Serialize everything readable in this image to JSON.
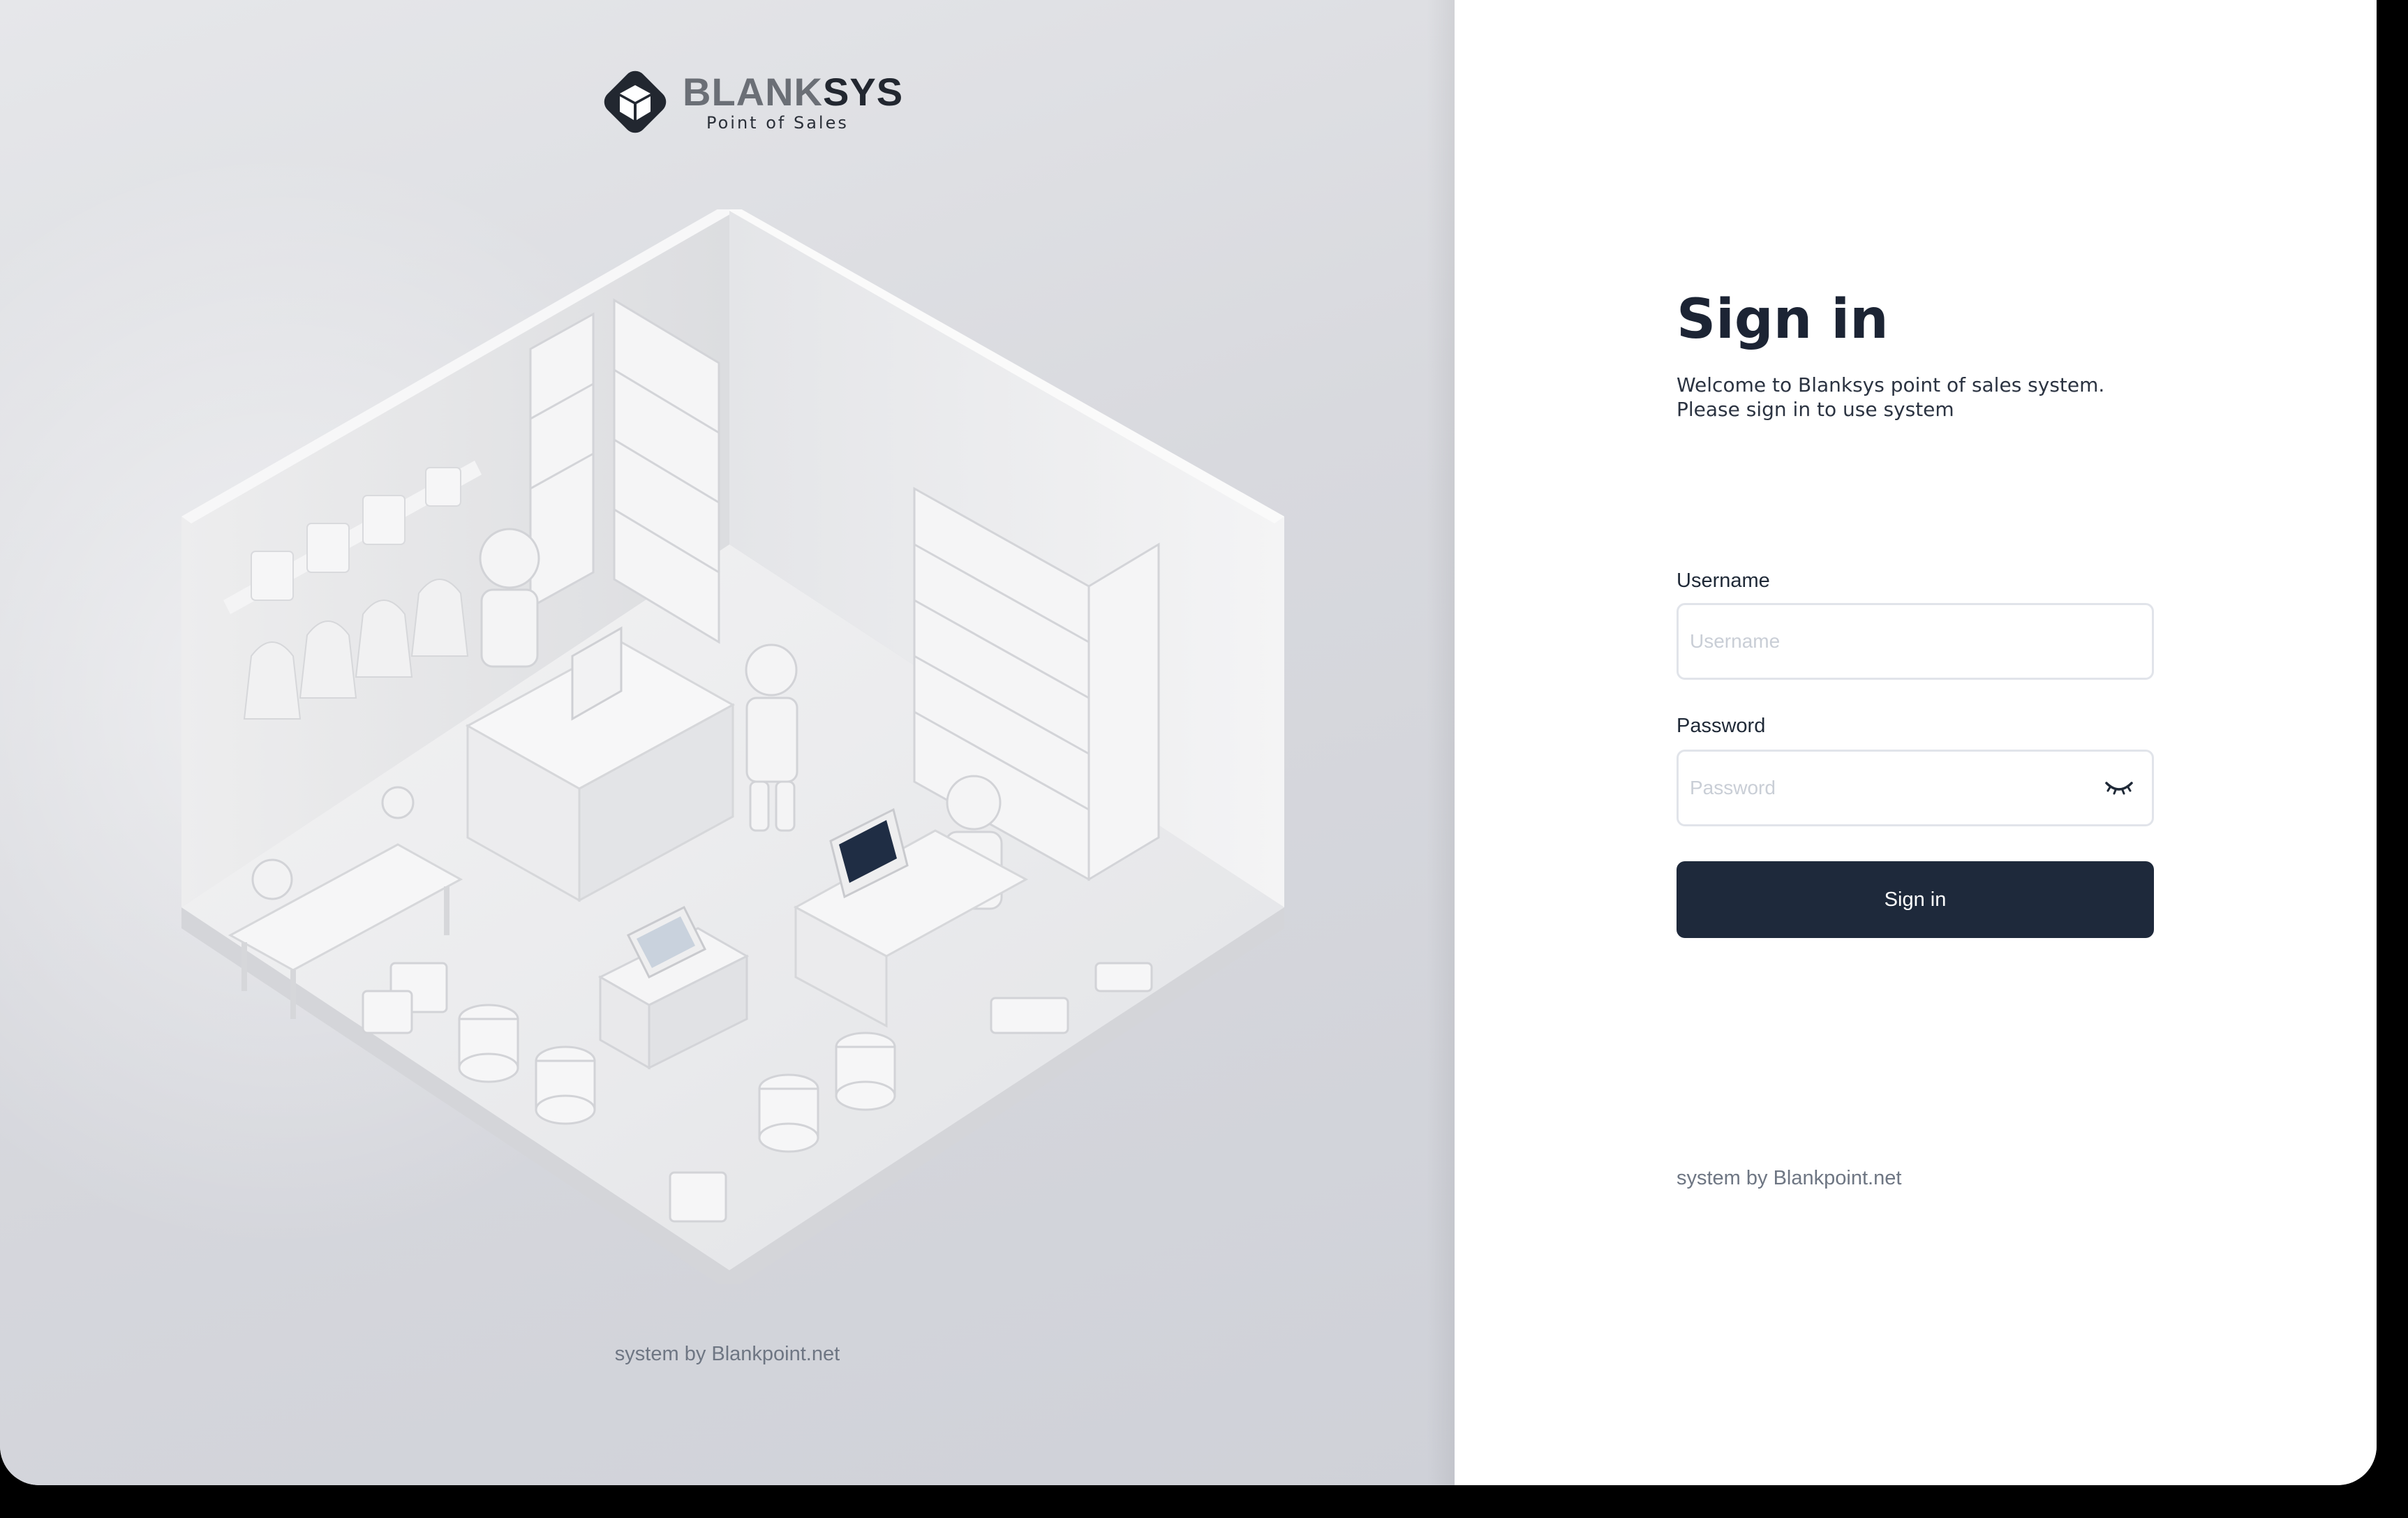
{
  "brand": {
    "name_part1": "BLANK",
    "name_part2": "SYS",
    "tagline": "Point of Sales",
    "colors": {
      "mark": "#222730",
      "name_light": "#6b6f76",
      "name_dark": "#222730"
    }
  },
  "illustration": {
    "icon": "isometric-store-illustration"
  },
  "left_footer": "system by Blankpoint.net",
  "signin": {
    "title": "Sign in",
    "subtitle": "Welcome to Blanksys point of sales system. Please sign in to use system",
    "username": {
      "label": "Username",
      "placeholder": "Username",
      "value": ""
    },
    "password": {
      "label": "Password",
      "placeholder": "Password",
      "value": "",
      "toggle_icon": "eye-closed-icon"
    },
    "button_label": "Sign in",
    "button_color": "#1e293b"
  },
  "right_footer": "system by Blankpoint.net"
}
